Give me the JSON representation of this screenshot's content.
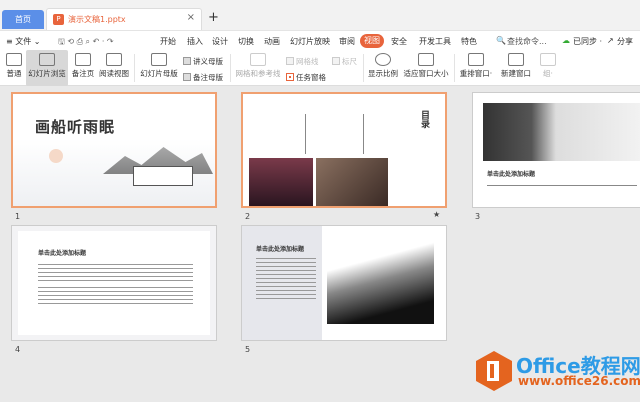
{
  "tabs": {
    "home": "首页",
    "doc_icon": "P",
    "doc": "演示文稿1.pptx",
    "close": "×",
    "new": "+"
  },
  "menu": {
    "file": "≡ 文件 ⌄",
    "items": [
      "开始",
      "插入",
      "设计",
      "切换",
      "动画",
      "幻灯片放映",
      "审阅",
      "视图",
      "安全",
      "开发工具",
      "特色"
    ],
    "active": "视图",
    "search": "查找命令...",
    "sync": "已同步 ·",
    "share": "分享"
  },
  "toolbar": {
    "normal": "普通",
    "sorter": "幻灯片浏览",
    "notes": "备注页",
    "reading": "阅读视图",
    "master": "幻灯片母版",
    "handout_master": "讲义母版",
    "notes_master": "备注母版",
    "grid": "网格和参考线",
    "gridlines": "网格线",
    "ruler": "标尺",
    "task_pane": "任务窗格",
    "zoom": "显示比例",
    "fit": "适应窗口大小",
    "arrange": "重排窗口·",
    "new_window": "新建窗口",
    "more": "组·"
  },
  "slides": [
    {
      "number": "1",
      "title": "画船听雨眠"
    },
    {
      "number": "2",
      "title": "目录",
      "marker": "★"
    },
    {
      "number": "3",
      "title": "单击此处添加标题"
    },
    {
      "number": "4",
      "title": "单击此处添加标题"
    },
    {
      "number": "5",
      "title": "单击此处添加标题"
    }
  ],
  "watermark": {
    "line1": "Office教程网",
    "line2": "www.office26.com"
  },
  "colors": {
    "accent": "#e8643c",
    "home_tab": "#5b8fe8"
  }
}
